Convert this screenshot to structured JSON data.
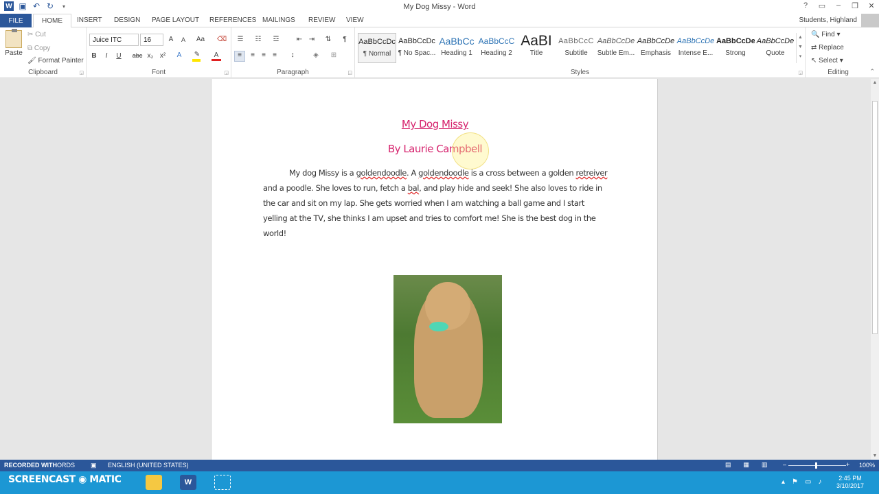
{
  "window": {
    "title": "My Dog Missy - Word",
    "user": "Students, Highland"
  },
  "tabs": [
    "FILE",
    "HOME",
    "INSERT",
    "DESIGN",
    "PAGE LAYOUT",
    "REFERENCES",
    "MAILINGS",
    "REVIEW",
    "VIEW"
  ],
  "clipboard": {
    "paste": "Paste",
    "cut": "Cut",
    "copy": "Copy",
    "format_painter": "Format Painter",
    "label": "Clipboard"
  },
  "font": {
    "name": "Juice ITC",
    "size": "16",
    "label": "Font",
    "grow": "A",
    "shrink": "A",
    "case": "Aa",
    "bold": "B",
    "italic": "I",
    "underline": "U",
    "strike": "abc",
    "sub": "x₂",
    "sup": "x²"
  },
  "paragraph": {
    "label": "Paragraph"
  },
  "styles": {
    "label": "Styles",
    "items": [
      {
        "preview": "AaBbCcDc",
        "label": "¶ Normal"
      },
      {
        "preview": "AaBbCcDc",
        "label": "¶ No Spac..."
      },
      {
        "preview": "AaBbCc",
        "label": "Heading 1"
      },
      {
        "preview": "AaBbCcC",
        "label": "Heading 2"
      },
      {
        "preview": "AaBI",
        "label": "Title"
      },
      {
        "preview": "AaBbCcC",
        "label": "Subtitle"
      },
      {
        "preview": "AaBbCcDe",
        "label": "Subtle Em..."
      },
      {
        "preview": "AaBbCcDe",
        "label": "Emphasis"
      },
      {
        "preview": "AaBbCcDe",
        "label": "Intense E..."
      },
      {
        "preview": "AaBbCcDe",
        "label": "Strong"
      },
      {
        "preview": "AaBbCcDe",
        "label": "Quote"
      }
    ]
  },
  "editing": {
    "find": "Find",
    "replace": "Replace",
    "select": "Select",
    "label": "Editing"
  },
  "document": {
    "title": "My Dog Missy",
    "byline": "By Laurie Campbell",
    "body": {
      "p1": "My dog Missy is a ",
      "w1": "goldendoodle",
      "p2": ".  A ",
      "w2": "goldendoodle",
      "p3": " is a cross between a golden ",
      "w3": "retreiver",
      "p4": " and a poodle.  She loves to run, fetch a ",
      "w4": "bal",
      "p5": ", and play hide and seek!  She also loves to ride in the car and sit on my lap.  She gets worried when I am watching a ball game and I start yelling at the TV, she thinks I am upset and tries to comfort me!  She is the best dog in the world!"
    }
  },
  "status": {
    "recorded": "RECORDED WITH",
    "words": "ORDS",
    "language": "ENGLISH (UNITED STATES)",
    "zoom": "100%"
  },
  "taskbar": {
    "brand": "SCREENCAST",
    "brand2": "MATIC",
    "time": "2:45 PM",
    "date": "3/10/2017"
  }
}
